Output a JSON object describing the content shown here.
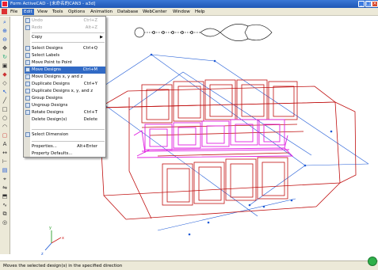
{
  "title": "Form ActiveCAD - [未命名的CAN3 - a3d]",
  "menubar": {
    "items": [
      "File",
      "Edit",
      "View",
      "Tools",
      "Options",
      "Animation",
      "Database",
      "WebCenter",
      "Window",
      "Help"
    ],
    "active": "Edit"
  },
  "edit_menu": {
    "items": [
      {
        "label": "Undo",
        "shortcut": "Ctrl+Z",
        "disabled": true,
        "icon": "undo-icon"
      },
      {
        "label": "Redo",
        "shortcut": "Alt+Z",
        "disabled": true,
        "icon": "redo-icon"
      },
      {
        "label": "Copy",
        "shortcut": "",
        "submenu": true
      },
      {
        "label": "Select Designs",
        "shortcut": "Ctrl+Q",
        "icon": "select-designs-icon"
      },
      {
        "label": "Select Labels",
        "shortcut": "",
        "icon": "select-labels-icon"
      },
      {
        "label": "Move Point to Point",
        "shortcut": "",
        "icon": "move-point-icon"
      },
      {
        "label": "Move Designs",
        "shortcut": "Ctrl+M",
        "highlight": true,
        "icon": "move-designs-icon"
      },
      {
        "label": "Move Designs x, y and z",
        "shortcut": "",
        "icon": "move-xyz-icon"
      },
      {
        "label": "Duplicate Designs",
        "shortcut": "Ctrl+Y",
        "icon": "duplicate-icon"
      },
      {
        "label": "Duplicate Designs x, y, and z",
        "shortcut": "",
        "icon": "duplicate-xyz-icon"
      },
      {
        "label": "Group Designs",
        "shortcut": "",
        "icon": "group-icon"
      },
      {
        "label": "Ungroup Designs",
        "shortcut": "",
        "icon": "ungroup-icon"
      },
      {
        "label": "Rotate Designs",
        "shortcut": "Ctrl+T",
        "icon": "rotate-icon"
      },
      {
        "label": "Delete Design(s)",
        "shortcut": "Delete",
        "icon": ""
      },
      {
        "label": "Select Dimension",
        "shortcut": "",
        "icon": "select-dimension-icon"
      },
      {
        "label": "Properties...",
        "shortcut": "Alt+Enter",
        "icon": ""
      },
      {
        "label": "Property Defaults...",
        "shortcut": "",
        "icon": ""
      }
    ]
  },
  "axes": {
    "x": "x",
    "y": "y",
    "z": "z"
  },
  "status": "Moves the selected design(s) in the specified direction",
  "colors": {
    "selected": "#e020e0",
    "model": "#c01010",
    "guide": "#1e5ad6",
    "highlight": "#316ac5"
  }
}
